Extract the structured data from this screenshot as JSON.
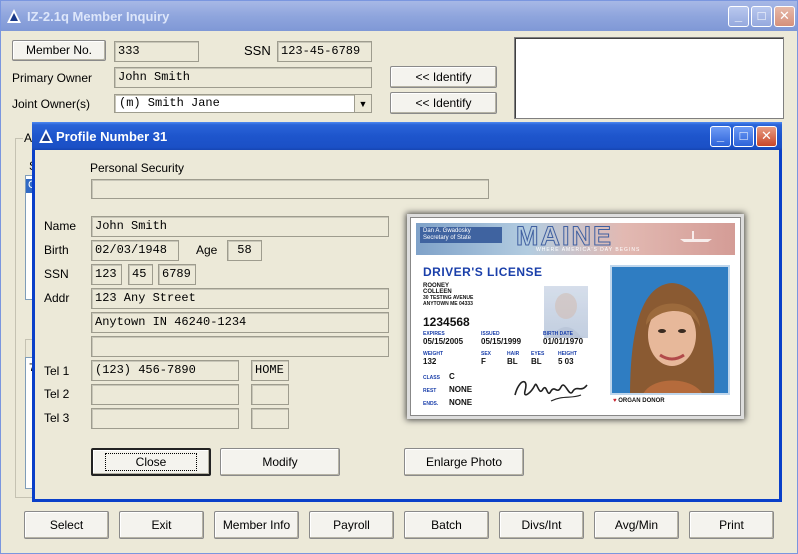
{
  "main_window": {
    "title": "IZ-2.1q  Member Inquiry",
    "member_no_button": "Member No.",
    "member_no": "333",
    "ssn_label": "SSN",
    "ssn": "123-45-6789",
    "primary_owner_label": "Primary Owner",
    "primary_owner": "John Smith",
    "joint_owners_label": "Joint Owner(s)",
    "joint_owner_selected": "(m) Smith Jane",
    "identify_primary_button": "<< Identify",
    "identify_joint_button": "<< Identify",
    "partial_label_a": "A",
    "partial_s": "S",
    "partial_c": "C",
    "partial_7": "7",
    "buttons": {
      "select": "Select",
      "exit": "Exit",
      "member_info": "Member Info",
      "payroll": "Payroll",
      "batch": "Batch",
      "divs_int": "Divs/Int",
      "avg_min": "Avg/Min",
      "print": "Print"
    }
  },
  "profile_dialog": {
    "title": "Profile Number 31",
    "personal_security_label": "Personal Security",
    "personal_security": "",
    "name_label": "Name",
    "name": "John Smith",
    "birth_label": "Birth",
    "birth": "02/03/1948",
    "age_label": "Age",
    "age": "58",
    "ssn_label": "SSN",
    "ssn_part1": "123",
    "ssn_part2": "45",
    "ssn_part3": "6789",
    "addr_label": "Addr",
    "addr_line1": "123 Any Street",
    "addr_line2": "Anytown IN 46240-1234",
    "addr_line3": "",
    "tel1_label": "Tel 1",
    "tel1": "(123) 456-7890",
    "tel1_type": "HOME",
    "tel2_label": "Tel 2",
    "tel2": "",
    "tel2_type": "",
    "tel3_label": "Tel 3",
    "tel3": "",
    "tel3_type": "",
    "close_button": "Close",
    "modify_button": "Modify",
    "enlarge_photo_button": "Enlarge Photo"
  },
  "license": {
    "state": "MAINE",
    "signed_by_line1": "Dan A. Gwadosky",
    "signed_by_line2": "Secretary of State",
    "tagline": "WHERE AMERICA'S DAY BEGINS",
    "doc_type": "DRIVER'S LICENSE",
    "surname": "ROONEY",
    "given_name": "COLLEEN",
    "address1": "30 TESTING AVENUE",
    "address2": "ANYTOWN ME 04333",
    "number": "1234568",
    "expires_label": "EXPIRES",
    "expires": "05/15/2005",
    "issued_label": "ISSUED",
    "issued": "05/15/1999",
    "birth_date_label": "BIRTH DATE",
    "birth_date": "01/01/1970",
    "weight_label": "WEIGHT",
    "weight": "132",
    "sex_label": "SEX",
    "sex": "F",
    "hair_label": "HAIR",
    "hair": "BL",
    "eyes_label": "EYES",
    "eyes": "BL",
    "height_label": "HEIGHT",
    "height": "5 03",
    "class_label": "CLASS",
    "class": "C",
    "rest_label": "REST",
    "rest": "NONE",
    "ends_label": "ENDS.",
    "ends": "NONE",
    "signature": "Colleen Rooney",
    "organ_donor": "ORGAN DONOR"
  },
  "colors": {
    "titlebar_active": "#1E55CC",
    "window_bg": "#ECE9D8",
    "license_title": "#1A3FAA",
    "close_button": "#C9472A"
  }
}
